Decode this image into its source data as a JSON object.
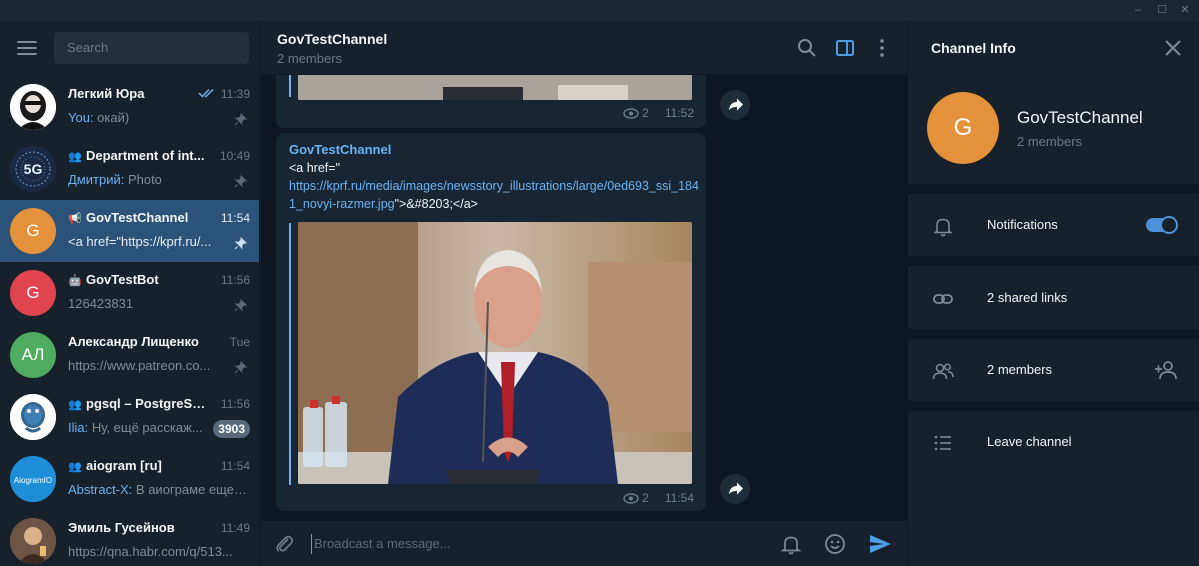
{
  "sidebar": {
    "search_placeholder": "Search",
    "chats": [
      {
        "name": "Легкий Юра",
        "time": "11:39",
        "sender": "You: ",
        "preview": "окай)",
        "avatar_text": "",
        "avatar_color": "#ffffff",
        "kind": "user"
      },
      {
        "name": "Department of int...",
        "time": "10:49",
        "sender": "Дмитрий: ",
        "preview": "Photo",
        "avatar_text": "5G",
        "avatar_color": "#1b2a44",
        "kind": "group"
      },
      {
        "name": "GovTestChannel",
        "time": "11:54",
        "sender": "",
        "preview": "<a href=\"https://kprf.ru/...",
        "avatar_text": "G",
        "avatar_color": "#e4913c",
        "kind": "channel"
      },
      {
        "name": "GovTestBot",
        "time": "11:56",
        "sender": "",
        "preview": "126423831",
        "avatar_text": "G",
        "avatar_color": "#e0444f",
        "kind": "bot"
      },
      {
        "name": "Александр Лищенко",
        "time": "Tue",
        "sender": "",
        "preview": "https://www.patreon.co...",
        "avatar_text": "АЛ",
        "avatar_color": "#4eab5f",
        "kind": "user"
      },
      {
        "name": "pgsql – PostgreSQL",
        "time": "11:56",
        "sender": "Ilia: ",
        "preview": "Ну, ещё расскаж...",
        "avatar_text": "",
        "avatar_color": "#ffffff",
        "kind": "group",
        "unread": "3903"
      },
      {
        "name": "aiogram [ru]",
        "time": "11:54",
        "sender": "Abstract-X: ",
        "preview": "В аиограме еще ...",
        "avatar_text": "",
        "avatar_color": "#1f8ed8",
        "kind": "group"
      },
      {
        "name": "Эмиль Гусейнов",
        "time": "11:49",
        "sender": "",
        "preview": "https://qna.habr.com/q/513...",
        "avatar_text": "",
        "avatar_color": "#8a6a55",
        "kind": "user"
      }
    ],
    "aiogram_logo": "AiogramIO"
  },
  "header": {
    "title": "GovTestChannel",
    "subtitle": "2 members"
  },
  "messages": {
    "first": {
      "views": "2",
      "time": "11:52"
    },
    "second": {
      "sender": "GovTestChannel",
      "text_prefix": "<a href=\"",
      "link": "https://kprf.ru/media/images/newsstory_illustrations/large/0ed693_ssi_1841_novyi-razmer.jpg",
      "text_suffix": "\">&#8203;</a>",
      "views": "2",
      "time": "11:54"
    }
  },
  "composer": {
    "placeholder": "Broadcast a message..."
  },
  "info": {
    "title": "Channel Info",
    "avatar_text": "G",
    "name": "GovTestChannel",
    "members": "2 members",
    "notifications_label": "Notifications",
    "notifications_on": true,
    "shared_links_label": "2 shared links",
    "members_label": "2 members",
    "leave_label": "Leave channel"
  },
  "colors": {
    "accent": "#6ab3f3",
    "active_chat": "#2b5278",
    "background": "#0e1621",
    "panel": "#17212b"
  }
}
